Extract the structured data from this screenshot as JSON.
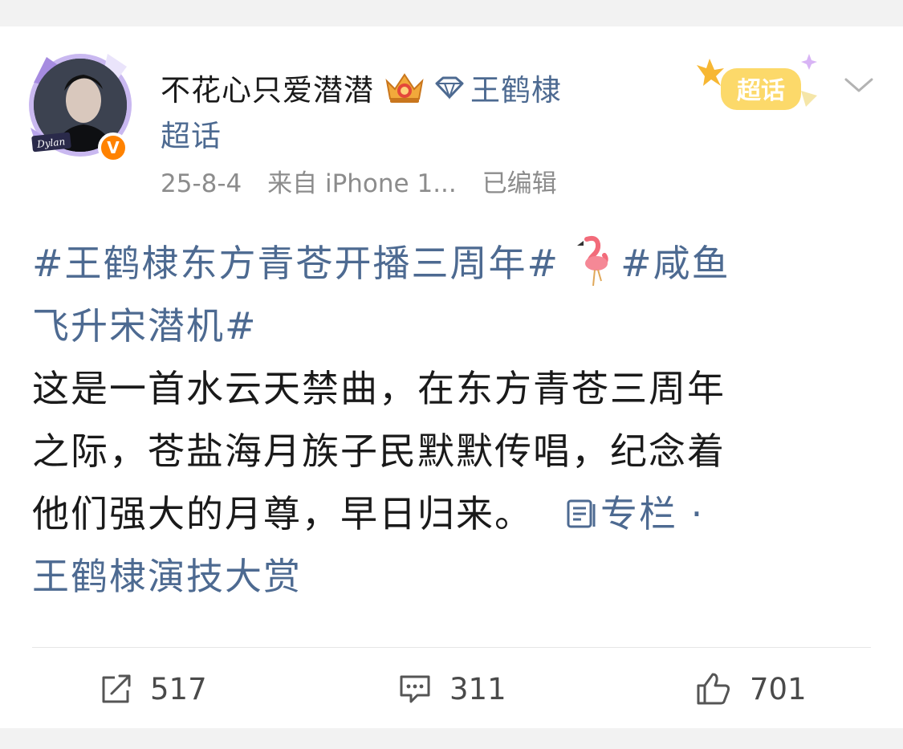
{
  "post": {
    "username": "不花心只爱潜潜",
    "topic_name": "王鹤棣",
    "topic_suffix": "超话",
    "date": "25-8-4",
    "source": "来自 iPhone 1...",
    "edited": "已编辑",
    "supertopic_badge_label": "超话",
    "avatar_signature": "Dylan",
    "verified_mark": "V",
    "hashtag1": "#王鹤棣东方青苍开播三周年#",
    "hashtag2_line1": "#咸鱼",
    "hashtag2_line2": "飞升宋潜机#",
    "body_line1": "这是一首水云天禁曲，在东方青苍三周年",
    "body_line2": "之际，苍盐海月族子民默默传唱，纪念着",
    "body_line3": "他们强大的月尊，早日归来。",
    "column_label": "专栏 ·",
    "column_title": "王鹤棣演技大赏"
  },
  "actions": {
    "repost_count": "517",
    "comment_count": "311",
    "like_count": "701"
  },
  "colors": {
    "link": "#4d6a91",
    "text": "#1a1a1a",
    "meta": "#8c8c8c",
    "verified": "#ff8200"
  },
  "icons": [
    "crown-icon",
    "diamond-icon",
    "supertopic-badge-icon",
    "chevron-down-icon",
    "flamingo-icon",
    "column-icon",
    "repost-icon",
    "comment-icon",
    "like-icon",
    "verified-icon"
  ]
}
